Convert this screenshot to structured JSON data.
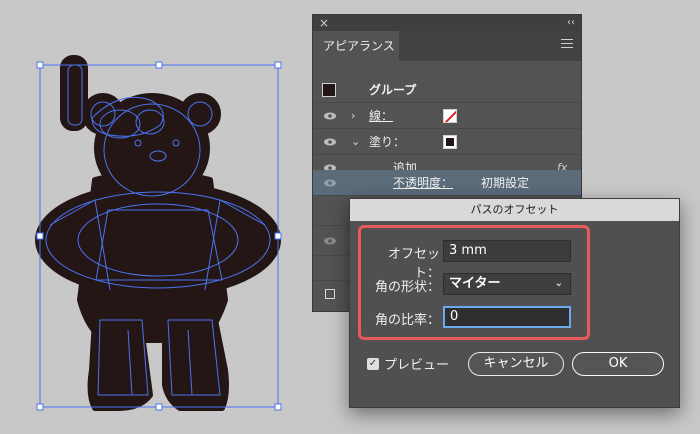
{
  "appearance_panel": {
    "close_glyph": "×",
    "collapse_glyph": "‹‹",
    "tab_label": "アピアランス",
    "group_label": "グループ",
    "stroke_label": "線：",
    "fill_label": "塗り：",
    "add_label": "追加",
    "fx_label": "fx",
    "opacity_label": "不透明度：",
    "opacity_value": "初期設定",
    "expand_glyph": "›",
    "collapse_row_glyph": "⌄"
  },
  "offset_dialog": {
    "title": "パスのオフセット",
    "offset_label": "オフセット：",
    "offset_value": "3 mm",
    "join_label": "角の形状：",
    "join_value": "マイター",
    "miter_label": "角の比率：",
    "miter_value": "0",
    "preview_label": "プレビュー",
    "preview_checked": "✓",
    "cancel_label": "キャンセル",
    "ok_label": "OK"
  },
  "colors": {
    "artwork_fill": "#241615",
    "selection_blue": "#4a74f0",
    "highlight": "#e85a5a"
  }
}
